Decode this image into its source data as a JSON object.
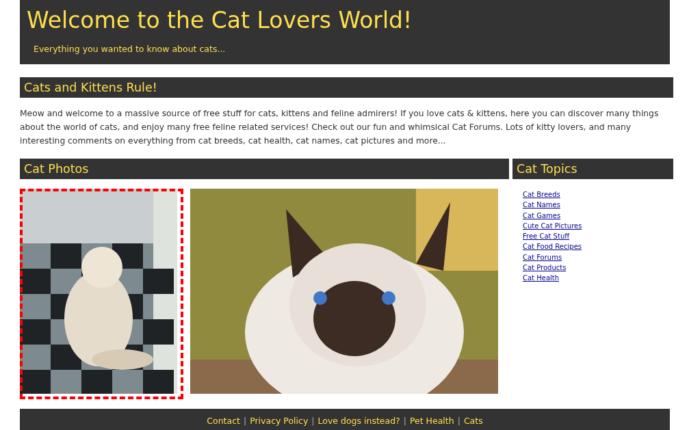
{
  "header": {
    "title": "Welcome to the Cat Lovers World!",
    "tagline": "Everything you wanted to know about cats..."
  },
  "intro": {
    "heading": "Cats and Kittens Rule!",
    "text": "Meow and welcome to a massive source of free stuff for cats, kittens and feline admirers! If you love cats & kittens, here you can discover many things about the world of cats, and enjoy many free feline related services! Check out our fun and whimsical Cat Forums. Lots of kitty lovers, and many interesting comments on everything from cat breeds, cat health, cat names, cat pictures and more..."
  },
  "photos": {
    "heading": "Cat Photos",
    "items": [
      {
        "kind": "persian",
        "selected": true
      },
      {
        "kind": "siamese",
        "selected": false
      }
    ]
  },
  "topics": {
    "heading": "Cat Topics",
    "links": [
      "Cat Breeds",
      "Cat Names",
      "Cat Games",
      "Cute Cat Pictures",
      "Free Cat Stuff",
      "Cat Food Recipes",
      "Cat Forums",
      "Cat Products",
      "Cat Health"
    ]
  },
  "footer": {
    "items": [
      {
        "kind": "link",
        "text": "Contact"
      },
      {
        "kind": "separator",
        "text": "|"
      },
      {
        "kind": "link",
        "text": "Privacy Policy"
      },
      {
        "kind": "separator",
        "text": "|"
      },
      {
        "kind": "link",
        "text": "Love dogs instead?"
      },
      {
        "kind": "separator",
        "text": "|"
      },
      {
        "kind": "link",
        "text": "Pet Health"
      },
      {
        "kind": "separator",
        "text": "|"
      },
      {
        "kind": "link",
        "text": "Cats"
      }
    ]
  }
}
